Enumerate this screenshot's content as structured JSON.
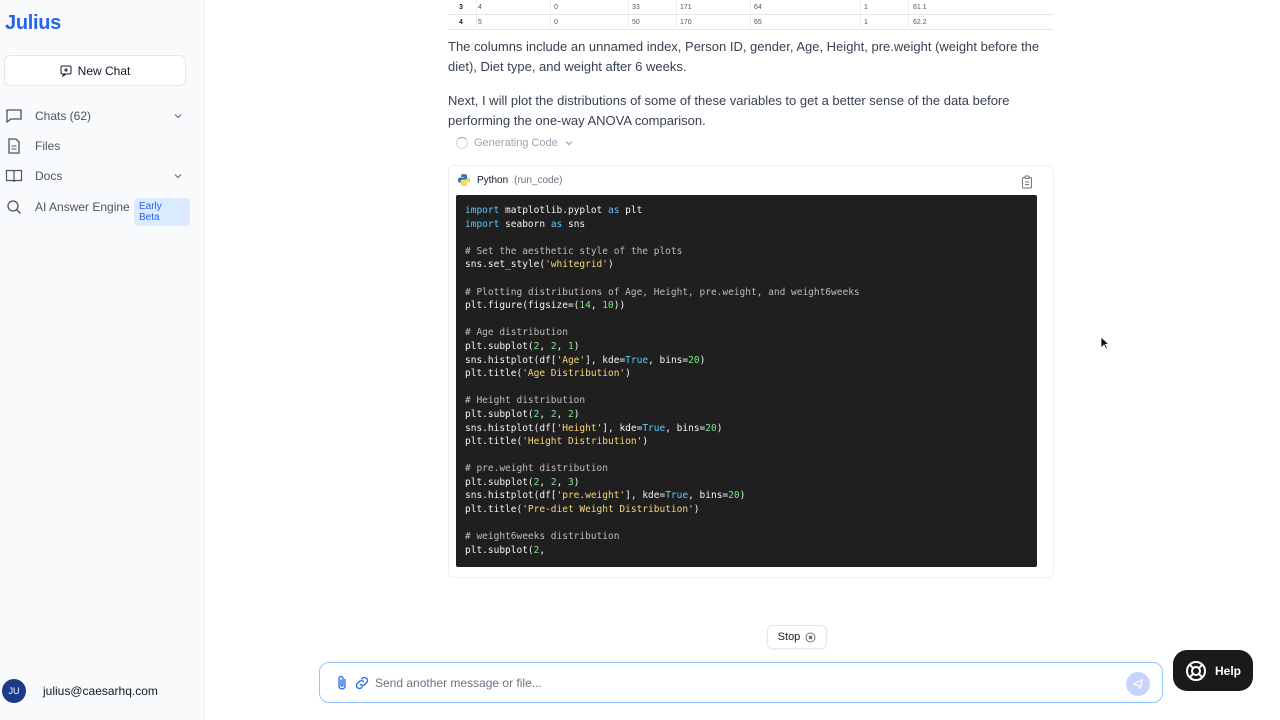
{
  "sidebar": {
    "logo": "Julius",
    "new_chat_label": "New Chat",
    "items": [
      {
        "label": "Chats  (62)",
        "icon": "chat-icon",
        "has_chevron": true
      },
      {
        "label": "Files",
        "icon": "file-icon",
        "has_chevron": false
      },
      {
        "label": "Docs",
        "icon": "book-icon",
        "has_chevron": true
      },
      {
        "label": "AI Answer Engine",
        "icon": "search-icon",
        "badge": "Early Beta"
      }
    ],
    "user": {
      "initials": "JU",
      "email": "julius@caesarhq.com"
    }
  },
  "table_fragment": {
    "rows": [
      {
        "idx": "3",
        "cells": [
          "4",
          "0",
          "33",
          "171",
          "64",
          "1",
          "61.1"
        ]
      },
      {
        "idx": "4",
        "cells": [
          "5",
          "0",
          "50",
          "170",
          "65",
          "1",
          "62.2"
        ]
      }
    ]
  },
  "messages": {
    "para1": "The columns include an unnamed index, Person ID, gender, Age, Height, pre.weight (weight before the diet), Diet type, and weight after 6 weeks.",
    "para2": "Next, I will plot the distributions of some of these variables to get a better sense of the data before performing the one-way ANOVA comparison.",
    "status": "Generating Code"
  },
  "code_block": {
    "language": "Python",
    "tool": "(run_code)",
    "lines": [
      [
        [
          "kw",
          "import"
        ],
        [
          "t",
          " matplotlib.pyplot "
        ],
        [
          "kw",
          "as"
        ],
        [
          "t",
          " plt"
        ]
      ],
      [
        [
          "kw",
          "import"
        ],
        [
          "t",
          " seaborn "
        ],
        [
          "kw",
          "as"
        ],
        [
          "t",
          " sns"
        ]
      ],
      [],
      [
        [
          "cm",
          "# Set the aesthetic style of the plots"
        ]
      ],
      [
        [
          "t",
          "sns.set_style("
        ],
        [
          "st",
          "'whitegrid'"
        ],
        [
          "t",
          ")"
        ]
      ],
      [],
      [
        [
          "cm",
          "# Plotting distributions of Age, Height, pre.weight, and weight6weeks"
        ]
      ],
      [
        [
          "t",
          "plt.figure(figsize=("
        ],
        [
          "nm",
          "14"
        ],
        [
          "t",
          ", "
        ],
        [
          "nm",
          "10"
        ],
        [
          "t",
          "))"
        ]
      ],
      [],
      [
        [
          "cm",
          "# Age distribution"
        ]
      ],
      [
        [
          "t",
          "plt.subplot("
        ],
        [
          "nm",
          "2"
        ],
        [
          "t",
          ", "
        ],
        [
          "nm",
          "2"
        ],
        [
          "t",
          ", "
        ],
        [
          "nm",
          "1"
        ],
        [
          "t",
          ")"
        ]
      ],
      [
        [
          "t",
          "sns.histplot(df["
        ],
        [
          "st",
          "'Age'"
        ],
        [
          "t",
          "], kde="
        ],
        [
          "bo",
          "True"
        ],
        [
          "t",
          ", bins="
        ],
        [
          "nm",
          "20"
        ],
        [
          "t",
          ")"
        ]
      ],
      [
        [
          "t",
          "plt.title("
        ],
        [
          "st",
          "'Age Distribution'"
        ],
        [
          "t",
          ")"
        ]
      ],
      [],
      [
        [
          "cm",
          "# Height distribution"
        ]
      ],
      [
        [
          "t",
          "plt.subplot("
        ],
        [
          "nm",
          "2"
        ],
        [
          "t",
          ", "
        ],
        [
          "nm",
          "2"
        ],
        [
          "t",
          ", "
        ],
        [
          "nm",
          "2"
        ],
        [
          "t",
          ")"
        ]
      ],
      [
        [
          "t",
          "sns.histplot(df["
        ],
        [
          "st",
          "'Height'"
        ],
        [
          "t",
          "], kde="
        ],
        [
          "bo",
          "True"
        ],
        [
          "t",
          ", bins="
        ],
        [
          "nm",
          "20"
        ],
        [
          "t",
          ")"
        ]
      ],
      [
        [
          "t",
          "plt.title("
        ],
        [
          "st",
          "'Height Distribution'"
        ],
        [
          "t",
          ")"
        ]
      ],
      [],
      [
        [
          "cm",
          "# pre.weight distribution"
        ]
      ],
      [
        [
          "t",
          "plt.subplot("
        ],
        [
          "nm",
          "2"
        ],
        [
          "t",
          ", "
        ],
        [
          "nm",
          "2"
        ],
        [
          "t",
          ", "
        ],
        [
          "nm",
          "3"
        ],
        [
          "t",
          ")"
        ]
      ],
      [
        [
          "t",
          "sns.histplot(df["
        ],
        [
          "st",
          "'pre.weight'"
        ],
        [
          "t",
          "], kde="
        ],
        [
          "bo",
          "True"
        ],
        [
          "t",
          ", bins="
        ],
        [
          "nm",
          "20"
        ],
        [
          "t",
          ")"
        ]
      ],
      [
        [
          "t",
          "plt.title("
        ],
        [
          "st",
          "'Pre-diet Weight Distribution'"
        ],
        [
          "t",
          ")"
        ]
      ],
      [],
      [
        [
          "cm",
          "# weight6weeks distribution"
        ]
      ],
      [
        [
          "t",
          "plt.subplot("
        ],
        [
          "nm",
          "2"
        ],
        [
          "t",
          ","
        ]
      ]
    ]
  },
  "stop_label": "Stop",
  "composer": {
    "placeholder": "Send another message or file..."
  },
  "help_label": "Help",
  "colors": {
    "accent": "#2563eb",
    "code_bg": "#1f1f1f",
    "input_border": "#93c5fd"
  }
}
